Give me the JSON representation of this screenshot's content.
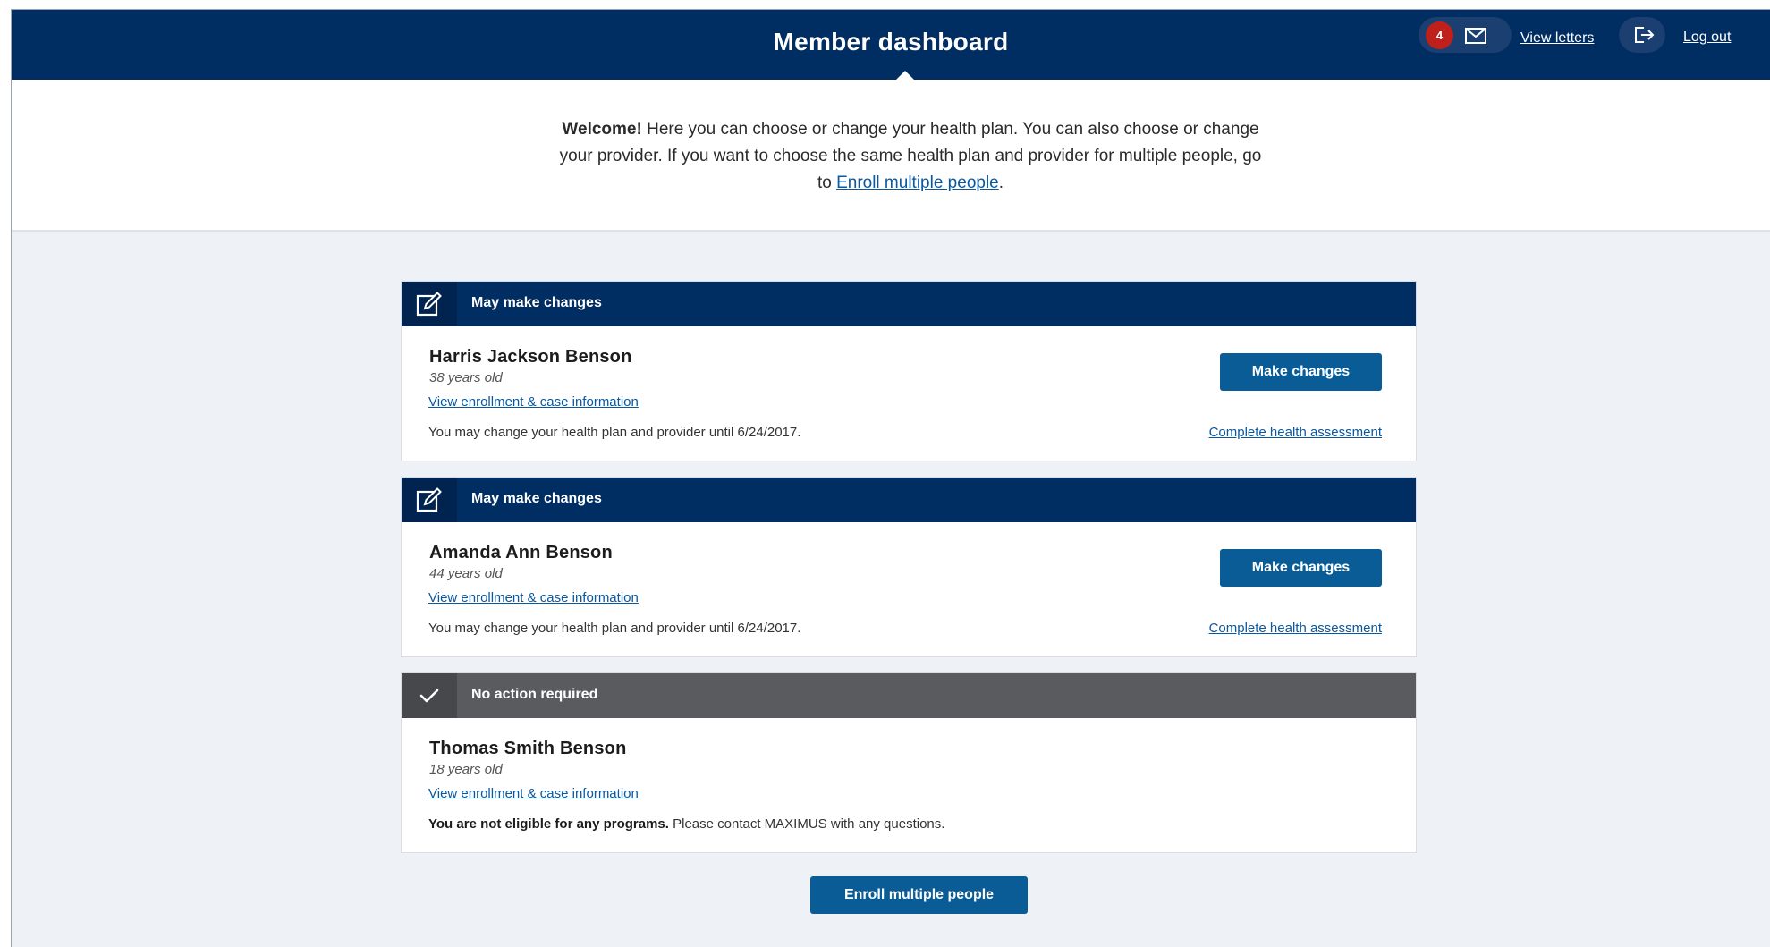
{
  "header": {
    "title": "Member dashboard",
    "letters_count": "4",
    "view_letters_label": "View letters",
    "logout_label": "Log out",
    "mail_icon": "envelope-icon",
    "logout_icon": "logout-icon"
  },
  "welcome": {
    "lead": "Welcome!",
    "text": " Here you can choose or change your health plan. You can also choose or change your provider. If you want to choose the same health plan and provider for multiple people, go to ",
    "link": "Enroll multiple people",
    "end": "."
  },
  "members": [
    {
      "status": "May make changes",
      "status_icon": "edit-icon",
      "name": "Harris Jackson Benson",
      "age": "38 years old",
      "view_info": "View enrollment & case information",
      "note": "You may change your health plan and provider until 6/24/2017.",
      "button": "Make changes",
      "assessment": "Complete health assessment"
    },
    {
      "status": "May make changes",
      "status_icon": "edit-icon",
      "name": "Amanda Ann Benson",
      "age": "44 years old",
      "view_info": "View enrollment & case information",
      "note": "You may change your health plan and provider until 6/24/2017.",
      "button": "Make changes",
      "assessment": "Complete health assessment"
    },
    {
      "status": "No action required",
      "status_icon": "checkmark-icon",
      "name": "Thomas Smith Benson",
      "age": "18 years old",
      "view_info": "View enrollment & case information",
      "note_bold": "You are not eligible for any programs.",
      "note": " Please contact MAXIMUS with any questions."
    }
  ],
  "footer": {
    "enroll_button": "Enroll multiple people"
  },
  "colors": {
    "header_bg": "#002d62",
    "button_bg": "#0a5c96",
    "badge_bg": "#c0201b",
    "gray_head": "#5a5b5f",
    "page_bg": "#eef1f5",
    "link": "#0a58a0"
  }
}
